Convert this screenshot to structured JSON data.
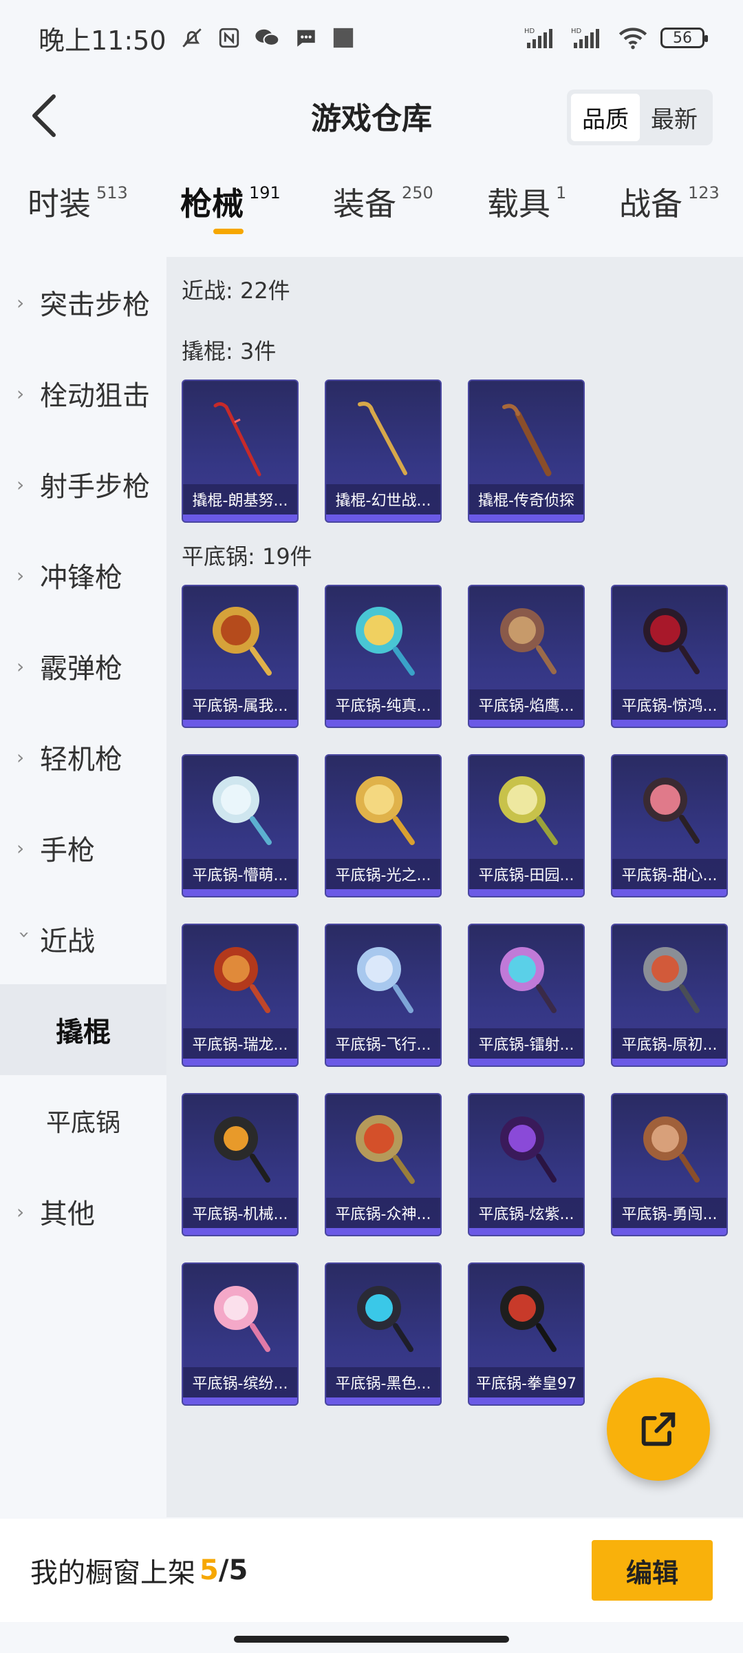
{
  "status_bar": {
    "time": "晚上11:50",
    "battery": "56",
    "net1": "HD",
    "net2": "HD"
  },
  "header": {
    "title": "游戏仓库",
    "sort_options": [
      "品质",
      "最新"
    ],
    "sort_selected": "品质"
  },
  "tabs": [
    {
      "label": "时装",
      "count": "513"
    },
    {
      "label": "枪械",
      "count": "191"
    },
    {
      "label": "装备",
      "count": "250"
    },
    {
      "label": "载具",
      "count": "1"
    },
    {
      "label": "战备",
      "count": "123"
    }
  ],
  "sidebar": {
    "items": [
      "突击步枪",
      "栓动狙击",
      "射手步枪",
      "冲锋枪",
      "霰弹枪",
      "轻机枪",
      "手枪",
      "近战"
    ],
    "subitems": [
      "撬棍",
      "平底锅"
    ],
    "other": "其他"
  },
  "main": {
    "category_summary": "近战: 22件",
    "crowbar_section": "撬棍: 3件",
    "pan_section": "平底锅: 19件",
    "crowbars": [
      {
        "name": "撬棍-朗基努..."
      },
      {
        "name": "撬棍-幻世战..."
      },
      {
        "name": "撬棍-传奇侦探"
      }
    ],
    "pans": [
      {
        "name": "平底锅-属我..."
      },
      {
        "name": "平底锅-纯真..."
      },
      {
        "name": "平底锅-焰鹰..."
      },
      {
        "name": "平底锅-惊鸿..."
      },
      {
        "name": "平底锅-懵萌..."
      },
      {
        "name": "平底锅-光之..."
      },
      {
        "name": "平底锅-田园..."
      },
      {
        "name": "平底锅-甜心..."
      },
      {
        "name": "平底锅-瑞龙..."
      },
      {
        "name": "平底锅-飞行..."
      },
      {
        "name": "平底锅-镭射..."
      },
      {
        "name": "平底锅-原初..."
      },
      {
        "name": "平底锅-机械..."
      },
      {
        "name": "平底锅-众神..."
      },
      {
        "name": "平底锅-炫紫..."
      },
      {
        "name": "平底锅-勇闯..."
      },
      {
        "name": "平底锅-缤纷..."
      },
      {
        "name": "平底锅-黑色..."
      },
      {
        "name": "平底锅-拳皇97"
      }
    ]
  },
  "bottom_bar": {
    "label": "我的橱窗上架",
    "current": "5",
    "sep_total": "/5",
    "edit": "编辑"
  },
  "colors": {
    "accent": "#f6a700",
    "fab": "#f9b10b",
    "card": "#353785"
  }
}
